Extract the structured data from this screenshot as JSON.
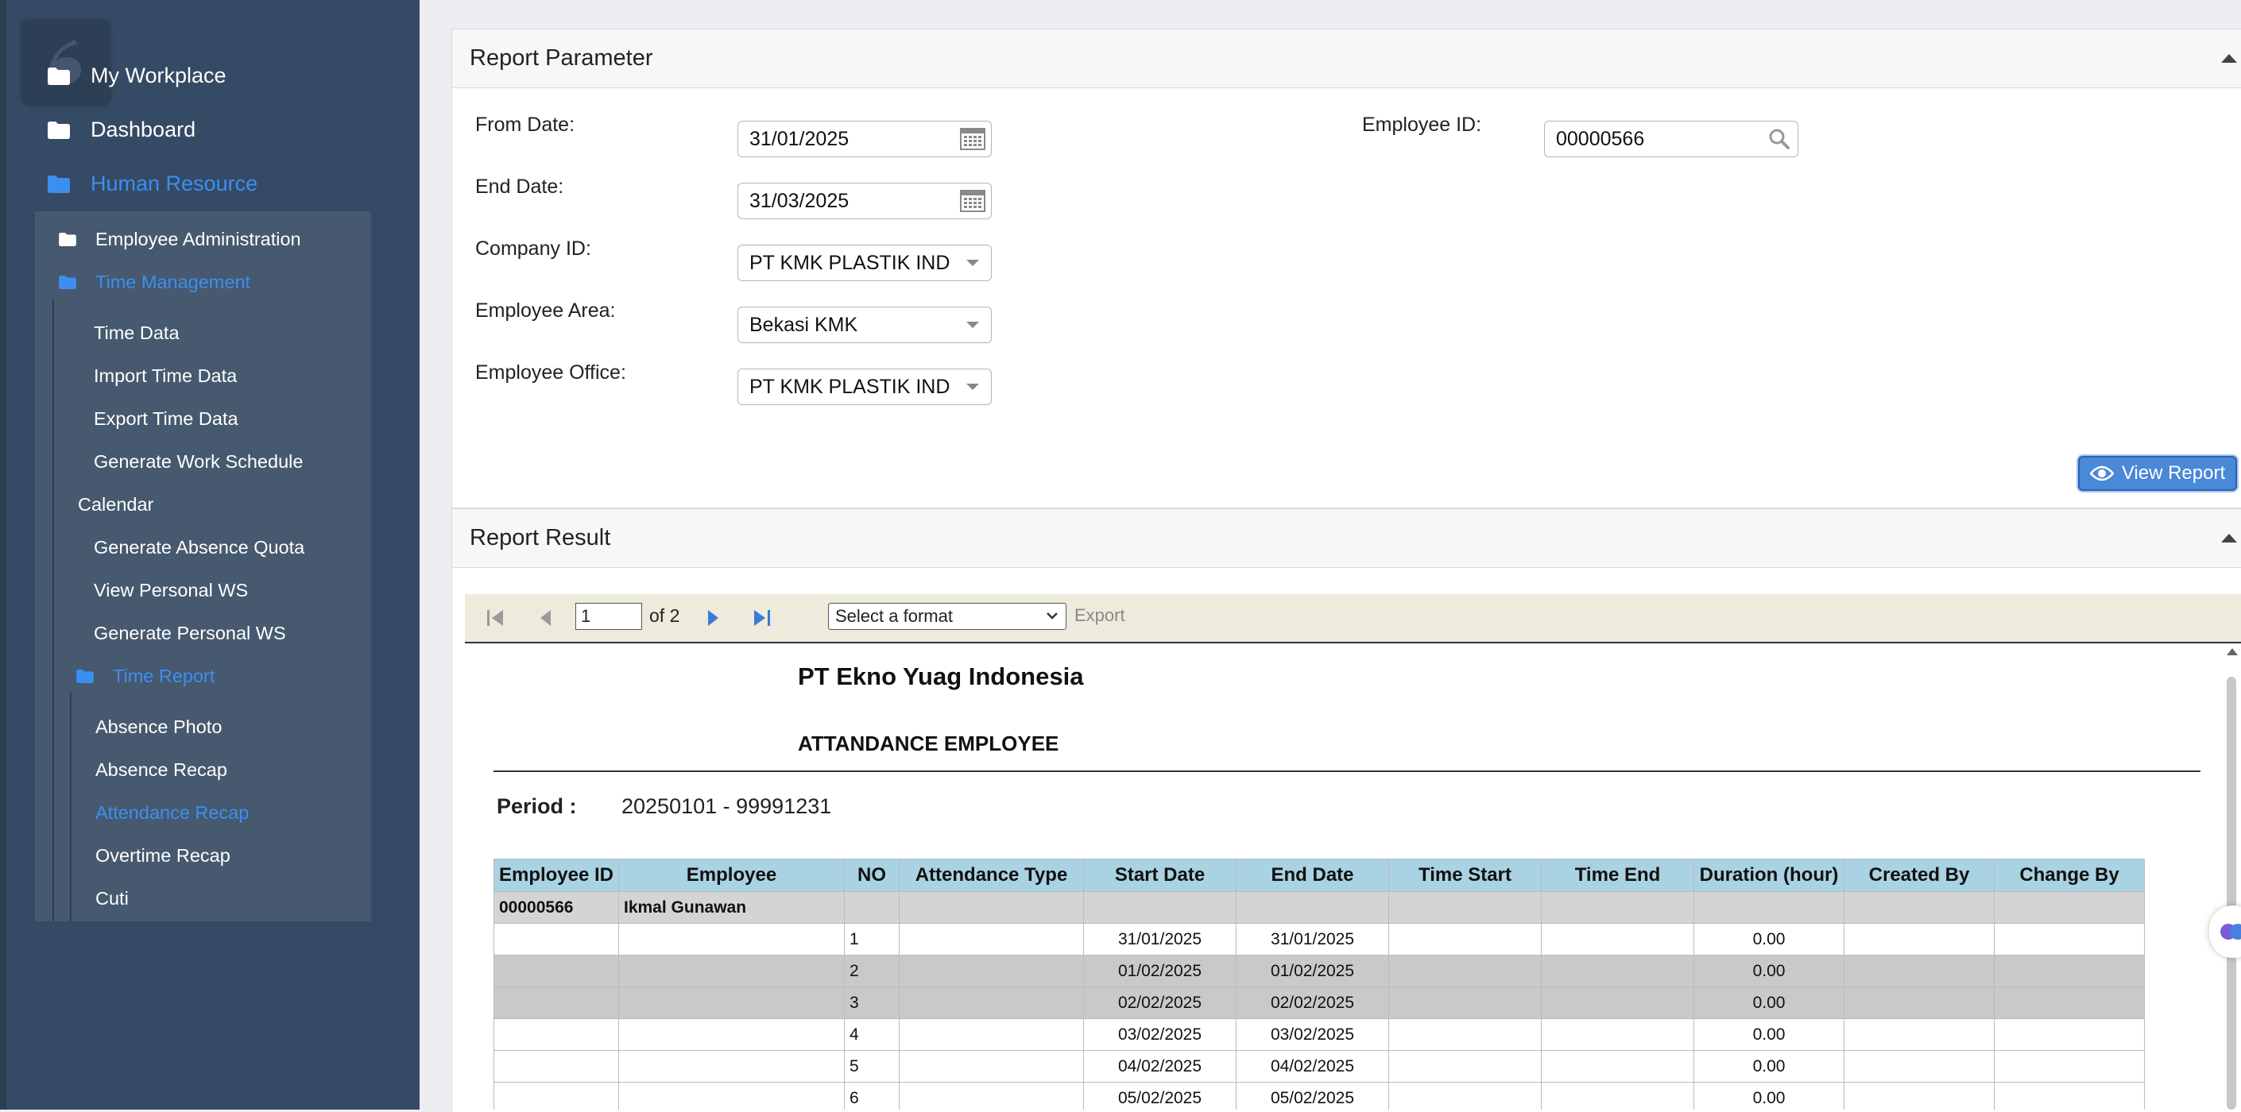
{
  "sidebar": {
    "top_items": [
      {
        "label": "My Workplace"
      },
      {
        "label": "Dashboard"
      },
      {
        "label": "Human Resource"
      }
    ],
    "submenu": {
      "employee_admin": "Employee Administration",
      "time_management": "Time Management",
      "time_items": [
        "Time Data",
        "Import Time Data",
        "Export Time Data",
        "Generate Work Schedule"
      ],
      "calendar": "Calendar",
      "more_items": [
        "Generate Absence Quota",
        "View Personal WS",
        "Generate Personal WS"
      ],
      "time_report": "Time Report",
      "report_items": [
        "Absence Photo",
        "Absence Recap",
        "Attendance Recap",
        "Overtime Recap",
        "Cuti"
      ]
    }
  },
  "params": {
    "title": "Report Parameter",
    "from_date_label": "From Date:",
    "from_date": "31/01/2025",
    "end_date_label": "End Date:",
    "end_date": "31/03/2025",
    "company_label": "Company ID:",
    "company": "PT KMK PLASTIK IND",
    "area_label": "Employee Area:",
    "area": "Bekasi KMK",
    "office_label": "Employee Office:",
    "office": "PT KMK PLASTIK IND",
    "employee_id_label": "Employee ID:",
    "employee_id": "00000566",
    "view_button": "View Report"
  },
  "result": {
    "title": "Report Result",
    "page": "1",
    "of_pages": "of 2",
    "format_placeholder": "Select a format",
    "export": "Export"
  },
  "report": {
    "company": "PT Ekno Yuag Indonesia",
    "title": "ATTANDANCE EMPLOYEE",
    "period_label": "Period :",
    "period_value": "20250101 - 99991231",
    "columns": [
      "Employee ID",
      "Employee",
      "NO",
      "Attendance Type",
      "Start Date",
      "End Date",
      "Time Start",
      "Time End",
      "Duration (hour)",
      "Created By",
      "Change By"
    ],
    "group": {
      "employee_id": "00000566",
      "employee": "Ikmal Gunawan"
    },
    "rows": [
      {
        "no": "1",
        "start": "31/01/2025",
        "end": "31/01/2025",
        "duration": "0.00"
      },
      {
        "no": "2",
        "start": "01/02/2025",
        "end": "01/02/2025",
        "duration": "0.00"
      },
      {
        "no": "3",
        "start": "02/02/2025",
        "end": "02/02/2025",
        "duration": "0.00"
      },
      {
        "no": "4",
        "start": "03/02/2025",
        "end": "03/02/2025",
        "duration": "0.00"
      },
      {
        "no": "5",
        "start": "04/02/2025",
        "end": "04/02/2025",
        "duration": "0.00"
      },
      {
        "no": "6",
        "start": "05/02/2025",
        "end": "05/02/2025",
        "duration": "0.00"
      }
    ]
  },
  "colors": {
    "sidebar_bg": "#354a64",
    "submenu_bg": "#46596f",
    "active_link": "#3b8ff0",
    "header_cell": "#a9d2e2",
    "shaded_row": "#c9c9c9",
    "button": "#4a88d8"
  }
}
